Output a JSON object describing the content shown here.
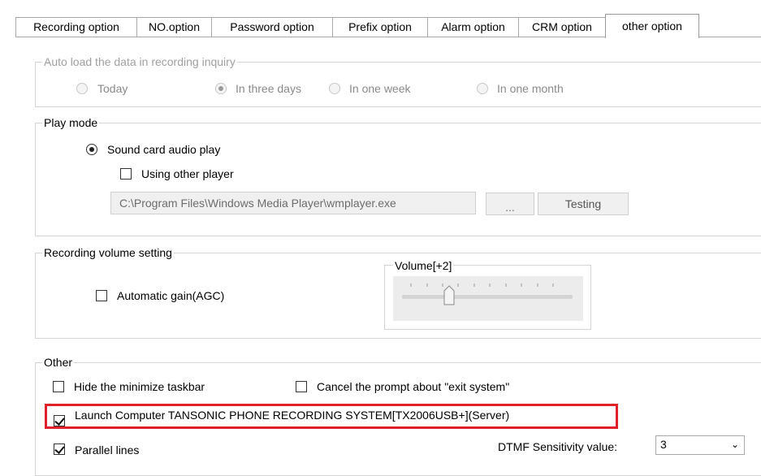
{
  "tabs": [
    "Recording option",
    "NO.option",
    "Password option",
    "Prefix option",
    "Alarm option",
    "CRM option",
    "other option"
  ],
  "auto_load": {
    "legend": "Auto load the data in recording inquiry",
    "options": [
      "Today",
      "In three days",
      "In one week",
      "In one month"
    ],
    "selected": "In three days"
  },
  "play_mode": {
    "legend": "Play mode",
    "sound_card_label": "Sound card audio play",
    "other_player_label": "Using other player",
    "player_path": "C:\\Program Files\\Windows Media Player\\wmplayer.exe",
    "browse_label": "...",
    "testing_label": "Testing"
  },
  "volume": {
    "legend": "Recording volume setting",
    "agc_label": "Automatic gain(AGC)",
    "agc_checked": false,
    "volume_legend": "Volume[+2]",
    "slider_value": 2,
    "slider_min": -2,
    "slider_max": 8
  },
  "other": {
    "legend": "Other",
    "hide_taskbar_label": "Hide the minimize taskbar",
    "cancel_prompt_label": "Cancel the prompt about \"exit system\"",
    "launch_label": "Launch Computer TANSONIC PHONE RECORDING SYSTEM[TX2006USB+](Server)",
    "launch_checked": true,
    "parallel_label": "Parallel lines",
    "parallel_checked": true,
    "dtmf_label": "DTMF Sensitivity value:",
    "dtmf_value": "3"
  },
  "colors": {
    "highlight": "#e0202a"
  }
}
